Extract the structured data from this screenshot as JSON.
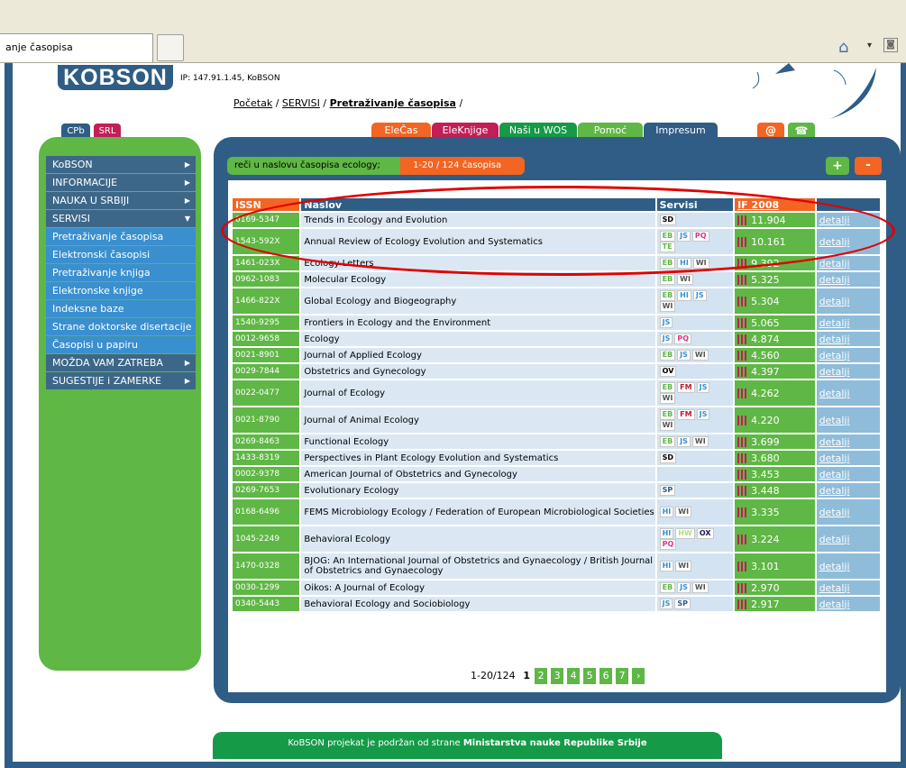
{
  "browser": {
    "tab_title": "anje časopisa"
  },
  "logo": {
    "text": "KOBSON"
  },
  "ip_text": "IP: 147.91.1.45, KoBSON",
  "breadcrumb": {
    "start": "Početak",
    "sep1": " / ",
    "servisi": "SERVISI",
    "sep2": " / ",
    "current": "Pretraživanje časopisa",
    "sep3": " /"
  },
  "top_buttons": {
    "cpb": "CPb",
    "srl": "SRL",
    "at": "@",
    "phone": "☎"
  },
  "nav": {
    "tabs": [
      "EleČas",
      "EleKnjige",
      "Naši u WOS",
      "Pomoć",
      "Impresum"
    ],
    "colors": [
      "#f26522",
      "#c21e58",
      "#159a48",
      "#5fb745",
      "#2f5d85"
    ]
  },
  "menu": {
    "items": [
      {
        "label": "KoBSON",
        "arrow": "▶"
      },
      {
        "label": "INFORMACIJE",
        "arrow": "▶"
      },
      {
        "label": "NAUKA U SRBIJI",
        "arrow": "▶"
      },
      {
        "label": "SERVISI",
        "arrow": "▼"
      }
    ],
    "sub": [
      "Pretraživanje časopisa",
      "Elektronski časopisi",
      "Pretraživanje knjiga",
      "Elektronske knjige",
      "Indeksne baze",
      "Strane doktorske disertacije",
      "Časopisi u papiru"
    ],
    "bottom": [
      {
        "label": "MOŽDA VAM ZATREBA",
        "arrow": "▶"
      },
      {
        "label": "SUGESTIJE i ZAMERKE",
        "arrow": "▶"
      }
    ]
  },
  "search": {
    "query": "reči u naslovu časopisa ecology;",
    "count": "1-20 / 124 časopisa",
    "plus": "+",
    "minus": "-"
  },
  "table": {
    "headers": {
      "issn": "ISSN",
      "title": "Naslov",
      "services": "Servisi",
      "if": "IF 2008",
      "details": ""
    },
    "rows": [
      {
        "issn": "0169-5347",
        "title": "Trends in Ecology and Evolution",
        "services": [
          "SD"
        ],
        "if": "11.904",
        "det": "detalji"
      },
      {
        "issn": "1543-592X",
        "title": "Annual Review of Ecology Evolution and Systematics",
        "services": [
          "EB",
          "JS",
          "PQ",
          "TE"
        ],
        "if": "10.161",
        "det": "detalji"
      },
      {
        "issn": "1461-023X",
        "title": "Ecology Letters",
        "services": [
          "EB",
          "HI",
          "WI"
        ],
        "if": "9.392",
        "det": "detalji"
      },
      {
        "issn": "0962-1083",
        "title": "Molecular Ecology",
        "services": [
          "EB",
          "WI"
        ],
        "if": "5.325",
        "det": "detalji"
      },
      {
        "issn": "1466-822X",
        "title": "Global Ecology and Biogeography",
        "services": [
          "EB",
          "HI",
          "JS",
          "WI"
        ],
        "if": "5.304",
        "det": "detalji"
      },
      {
        "issn": "1540-9295",
        "title": "Frontiers in Ecology and the Environment",
        "services": [
          "JS"
        ],
        "if": "5.065",
        "det": "detalji"
      },
      {
        "issn": "0012-9658",
        "title": "Ecology",
        "services": [
          "JS",
          "PQ"
        ],
        "if": "4.874",
        "det": "detalji"
      },
      {
        "issn": "0021-8901",
        "title": "Journal of Applied Ecology",
        "services": [
          "EB",
          "JS",
          "WI"
        ],
        "if": "4.560",
        "det": "detalji"
      },
      {
        "issn": "0029-7844",
        "title": "Obstetrics and Gynecology",
        "services": [
          "OV"
        ],
        "if": "4.397",
        "det": "detalji"
      },
      {
        "issn": "0022-0477",
        "title": "Journal of Ecology",
        "services": [
          "EB",
          "FM",
          "JS",
          "WI"
        ],
        "if": "4.262",
        "det": "detalji"
      },
      {
        "issn": "0021-8790",
        "title": "Journal of Animal Ecology",
        "services": [
          "EB",
          "FM",
          "JS",
          "WI"
        ],
        "if": "4.220",
        "det": "detalji"
      },
      {
        "issn": "0269-8463",
        "title": "Functional Ecology",
        "services": [
          "EB",
          "JS",
          "WI"
        ],
        "if": "3.699",
        "det": "detalji"
      },
      {
        "issn": "1433-8319",
        "title": "Perspectives in Plant Ecology Evolution and Systematics",
        "services": [
          "SD"
        ],
        "if": "3.680",
        "det": "detalji"
      },
      {
        "issn": "0002-9378",
        "title": "American Journal of Obstetrics and Gynecology",
        "services": [],
        "if": "3.453",
        "det": "detalji"
      },
      {
        "issn": "0269-7653",
        "title": "Evolutionary Ecology",
        "services": [
          "SP"
        ],
        "if": "3.448",
        "det": "detalji"
      },
      {
        "issn": "0168-6496",
        "title": "FEMS Microbiology Ecology / Federation of European Microbiological Societies",
        "services": [
          "HI",
          "WI"
        ],
        "if": "3.335",
        "det": "detalji"
      },
      {
        "issn": "1045-2249",
        "title": "Behavioral Ecology",
        "services": [
          "HI",
          "HW",
          "OX",
          "PQ"
        ],
        "if": "3.224",
        "det": "detalji"
      },
      {
        "issn": "1470-0328",
        "title": "BJOG: An International Journal of Obstetrics and Gynaecology / British Journal of Obstetrics and Gynaecology",
        "services": [
          "HI",
          "WI"
        ],
        "if": "3.101",
        "det": "detalji"
      },
      {
        "issn": "0030-1299",
        "title": "Oikos: A Journal of Ecology",
        "services": [
          "EB",
          "JS",
          "WI"
        ],
        "if": "2.970",
        "det": "detalji"
      },
      {
        "issn": "0340-5443",
        "title": "Behavioral Ecology and Sociobiology",
        "services": [
          "JS",
          "SP"
        ],
        "if": "2.917",
        "det": "detalji"
      }
    ]
  },
  "badge_colors": {
    "SD": "#000000",
    "EB": "#5fb745",
    "JS": "#3a8fcf",
    "PQ": "#e0338a",
    "TE": "#5fb745",
    "HI": "#3a8fcf",
    "WI": "#555555",
    "OV": "#000000",
    "FM": "#c2182b",
    "SP": "#2f5d85",
    "HW": "#b8d88a",
    "OX": "#1a1a5e"
  },
  "pager": {
    "range": "1-20/124",
    "pages": [
      "1",
      "2",
      "3",
      "4",
      "5",
      "6",
      "7"
    ],
    "next": "›"
  },
  "footer": {
    "text": "KoBSON projekat je podržan od strane ",
    "bold": "Ministarstva nauke Republike Srbije"
  }
}
